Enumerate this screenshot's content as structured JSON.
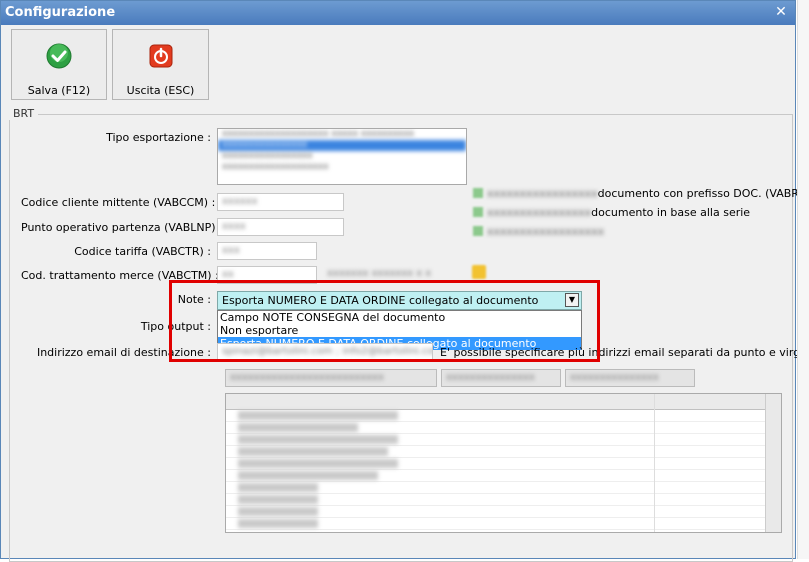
{
  "window": {
    "title": "Configurazione"
  },
  "toolbar": {
    "save_label": "Salva (F12)",
    "exit_label": "Uscita (ESC)"
  },
  "group": {
    "title": "BRT"
  },
  "form": {
    "tipo_esportazione_label": "Tipo esportazione :",
    "codice_cliente_label": "Codice cliente mittente (VABCCM) :",
    "punto_operativo_label": "Punto operativo partenza (VABLNP) :",
    "codice_tariffa_label": "Codice tariffa (VABCTR) :",
    "cod_trattamento_label": "Cod. trattamento merce (VABCTM) :",
    "note_label": "Note :",
    "tipo_output_label": "Tipo output :",
    "email_label": "Indirizzo email di destinazione :",
    "email_hint": "E' possibile specificare più indirizzi email separati da punto e virgola",
    "email_value": "spinazi@bartolini.com ; info2@bartolini.com"
  },
  "options": {
    "opt1_visible": "documento con prefisso DOC. (VABRMA)",
    "opt2_visible": "documento in base alla serie"
  },
  "note": {
    "selected": "Esporta NUMERO E DATA ORDINE collegato al documento",
    "options": [
      "Campo NOTE CONSEGNA del documento",
      "Non esportare",
      "Esporta NUMERO E DATA ORDINE collegato al documento"
    ]
  }
}
